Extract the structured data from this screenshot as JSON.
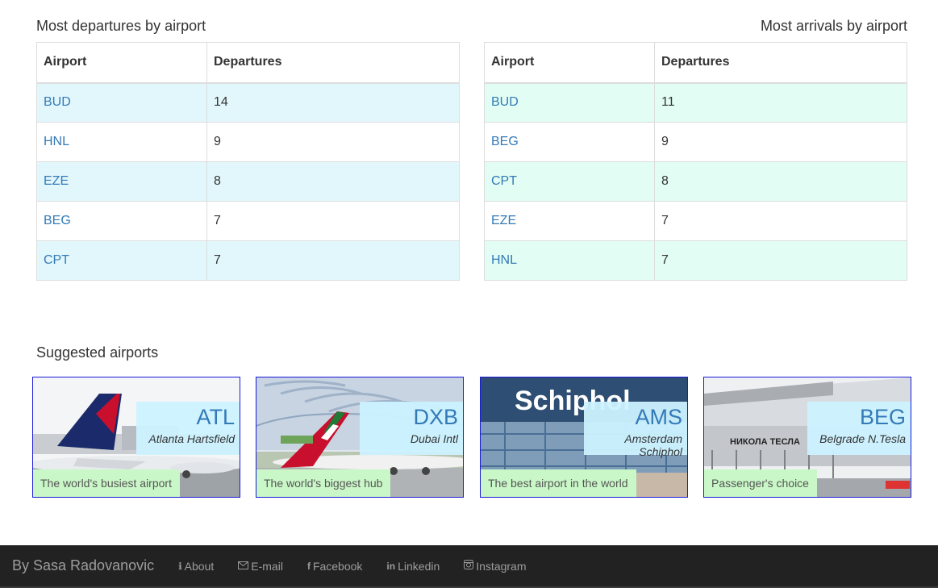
{
  "departures": {
    "title": "Most departures by airport",
    "headers": [
      "Airport",
      "Departures"
    ],
    "rows": [
      {
        "airport": "BUD",
        "count": "14"
      },
      {
        "airport": "HNL",
        "count": "9"
      },
      {
        "airport": "EZE",
        "count": "8"
      },
      {
        "airport": "BEG",
        "count": "7"
      },
      {
        "airport": "CPT",
        "count": "7"
      }
    ]
  },
  "arrivals": {
    "title": "Most arrivals by airport",
    "headers": [
      "Airport",
      "Departures"
    ],
    "rows": [
      {
        "airport": "BUD",
        "count": "11"
      },
      {
        "airport": "BEG",
        "count": "9"
      },
      {
        "airport": "CPT",
        "count": "8"
      },
      {
        "airport": "EZE",
        "count": "7"
      },
      {
        "airport": "HNL",
        "count": "7"
      }
    ]
  },
  "suggested": {
    "title": "Suggested airports",
    "cards": [
      {
        "code": "ATL",
        "name": "Atlanta Hartsfield",
        "tagline": "The world's busiest airport",
        "photo": "delta-airplane-photo"
      },
      {
        "code": "DXB",
        "name": "Dubai Intl",
        "tagline": "The world's biggest hub",
        "photo": "emirates-airplane-photo"
      },
      {
        "code": "AMS",
        "name": "Amsterdam Schiphol",
        "tagline": "The best airport in the world",
        "photo": "schiphol-terminal-photo",
        "photo_sign": "Schiphol"
      },
      {
        "code": "BEG",
        "name": "Belgrade N.Tesla",
        "tagline": "Passenger's choice",
        "photo": "belgrade-terminal-photo",
        "photo_sign": "НИКОЛА ТЕСЛА"
      }
    ]
  },
  "footer": {
    "brand": "By Sasa Radovanovic",
    "links": [
      {
        "label": "About",
        "icon": "info-icon"
      },
      {
        "label": "E-mail",
        "icon": "envelope-icon"
      },
      {
        "label": "Facebook",
        "icon": "facebook-icon"
      },
      {
        "label": "Linkedin",
        "icon": "linkedin-icon"
      },
      {
        "label": "Instagram",
        "icon": "instagram-icon"
      }
    ]
  },
  "colors": {
    "link": "#337ab7",
    "departures_stripe": "#e2f7fc",
    "arrivals_stripe": "#e2fdf3",
    "badge": "#ccf2ff",
    "tagline": "#c9f7c7",
    "footer_bg": "#222222"
  }
}
